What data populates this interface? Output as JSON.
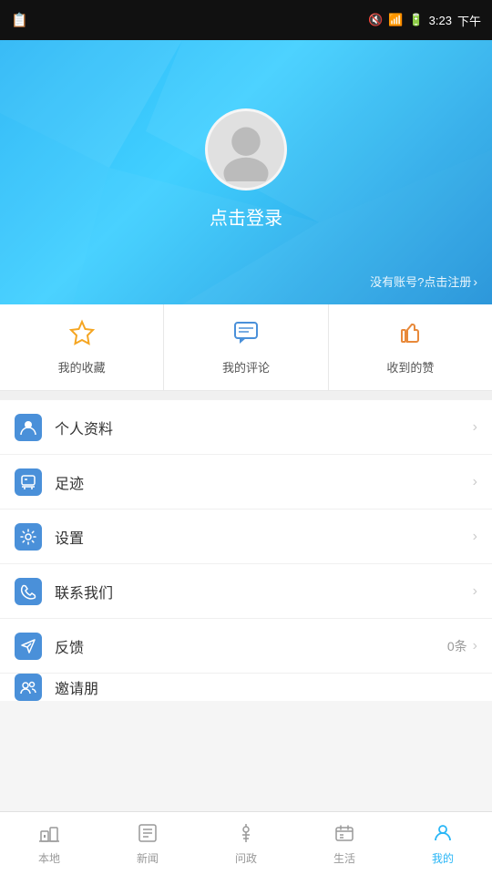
{
  "statusBar": {
    "time": "3:23",
    "period": "下午",
    "batteryIcon": "🔋",
    "wifiIcon": "📶",
    "muteIcon": "🔇"
  },
  "profile": {
    "loginText": "点击登录",
    "registerText": "没有账号?点击注册",
    "avatarAlt": "avatar"
  },
  "quickActions": [
    {
      "id": "favorites",
      "label": "我的收藏",
      "iconType": "star"
    },
    {
      "id": "comments",
      "label": "我的评论",
      "iconType": "comment"
    },
    {
      "id": "likes",
      "label": "收到的赞",
      "iconType": "thumb"
    }
  ],
  "menuItems": [
    {
      "id": "profile",
      "label": "个人资料",
      "iconSymbol": "👤",
      "badge": ""
    },
    {
      "id": "footprint",
      "label": "足迹",
      "iconSymbol": "🚩",
      "badge": ""
    },
    {
      "id": "settings",
      "label": "设置",
      "iconSymbol": "⚙️",
      "badge": ""
    },
    {
      "id": "contact",
      "label": "联系我们",
      "iconSymbol": "📞",
      "badge": ""
    },
    {
      "id": "feedback",
      "label": "反馈",
      "iconSymbol": "✈",
      "badge": "0条"
    },
    {
      "id": "invite",
      "label": "邀请朋",
      "iconSymbol": "👥",
      "badge": ""
    }
  ],
  "tabBar": {
    "items": [
      {
        "id": "local",
        "label": "本地",
        "icon": "local",
        "active": false
      },
      {
        "id": "news",
        "label": "新闻",
        "icon": "news",
        "active": false
      },
      {
        "id": "governance",
        "label": "问政",
        "icon": "gov",
        "active": false
      },
      {
        "id": "life",
        "label": "生活",
        "icon": "life",
        "active": false
      },
      {
        "id": "mine",
        "label": "我的",
        "icon": "mine",
        "active": true
      }
    ]
  }
}
